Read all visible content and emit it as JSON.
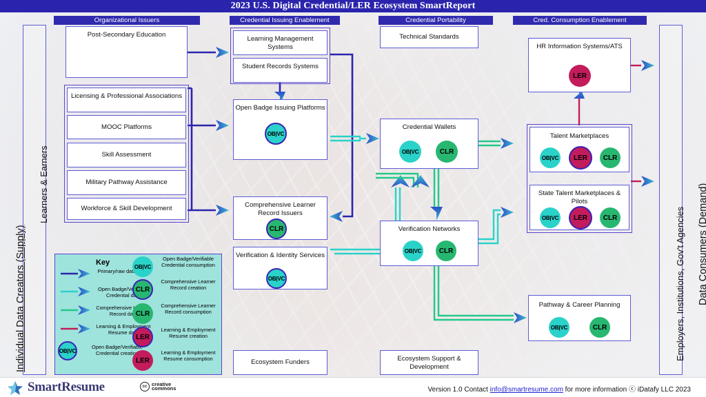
{
  "title": "2023 U.S. Digital Credential/LER Ecosystem SmartReport",
  "rails": {
    "left_outer": "Individual Data Creators (Supply)",
    "left_inner": "Learners & Earners",
    "right_inner": "Employers, Institutions, Gov't Agencies",
    "right_outer": "Data Consumers (Demand)"
  },
  "columns": [
    {
      "id": "organizational-issuers",
      "label": "Organizational Issuers"
    },
    {
      "id": "credential-issuing-enablement",
      "label": "Credential Issuing Enablement"
    },
    {
      "id": "credential-portability",
      "label": "Credential Portability"
    },
    {
      "id": "cred-consumption-enablement",
      "label": "Cred. Consumption Enablement"
    }
  ],
  "boxes": {
    "post_secondary": "Post-Secondary Education",
    "licensing": "Licensing & Professional Associations",
    "mooc": "MOOC Platforms",
    "skill_assessment": "Skill Assessment",
    "military": "Military Pathway Assistance",
    "workforce": "Workforce & Skill Development",
    "lms": "Learning Management Systems",
    "srs": "Student Records Systems",
    "open_badge": "Open Badge Issuing Platforms",
    "clr_issuers": "Comprehensive Learner Record Issuers",
    "verification_identity": "Verification & Identity Services",
    "ecosystem_funders": "Ecosystem Funders",
    "technical_standards": "Technical Standards",
    "credential_wallets": "Credential Wallets",
    "verification_networks": "Verification Networks",
    "ecosystem_support": "Ecosystem Support & Development",
    "hris": "HR Information Systems/ATS",
    "talent_marketplaces": "Talent Marketplaces",
    "state_talent": "State Talent Marketplaces & Pilots",
    "pathway_career": "Pathway & Career Planning"
  },
  "badges": {
    "obvc": "OB|VC",
    "clr": "CLR",
    "ler": "LER"
  },
  "key": {
    "title": "Key",
    "arrows": [
      {
        "color": "#2a24ad",
        "label": "Primary/raw data flow"
      },
      {
        "color": "#2ad2c9",
        "label": "Open Badge/Verifiable Credential data"
      },
      {
        "color": "#22c98a",
        "label": "Comprehensive Learner Record data"
      },
      {
        "color": "#c21c5c",
        "label": "Learning & Employment Resume data"
      }
    ],
    "swatches": [
      {
        "badge": "OB|VC",
        "kind": "obvc",
        "creation": true,
        "label": "Open Badge/Verifiable Credential creation"
      },
      {
        "badge": "OB|VC",
        "kind": "obvc",
        "creation": false,
        "label": "Open Badge/Verifiable Credential consumption"
      },
      {
        "badge": "CLR",
        "kind": "clr",
        "creation": true,
        "label": "Comprehensive Learner Record creation"
      },
      {
        "badge": "CLR",
        "kind": "clr",
        "creation": false,
        "label": "Comprehensive Learner Record consumption"
      },
      {
        "badge": "LER",
        "kind": "ler",
        "creation": true,
        "label": "Learning & Employment Resume creation"
      },
      {
        "badge": "LER",
        "kind": "ler",
        "creation": false,
        "label": "Learning & Employment Resume consumption"
      }
    ]
  },
  "footer": {
    "brand": "SmartResume",
    "cc_line1": "creative",
    "cc_line2": "commons",
    "cc_mark": "cc",
    "version_pre": "Version 1.0 Contact ",
    "email": "info@smartresume.com",
    "version_post": " for more information ⓒ iDatafy LLC 2023"
  },
  "colors": {
    "title_bar": "#2a24ad",
    "column_head": "#2f2aae",
    "box_border": "#5b5bd6",
    "group_border": "#5b43cf",
    "arrow_primary": "#2a24ad",
    "arrow_obvc": "#2ad2c9",
    "arrow_clr": "#22c98a",
    "arrow_ler": "#c21c5c",
    "badge_obvc": "#2ad2c9",
    "badge_clr": "#27b771",
    "badge_ler": "#c21c5c",
    "key_bg": "#9fe3dd"
  }
}
